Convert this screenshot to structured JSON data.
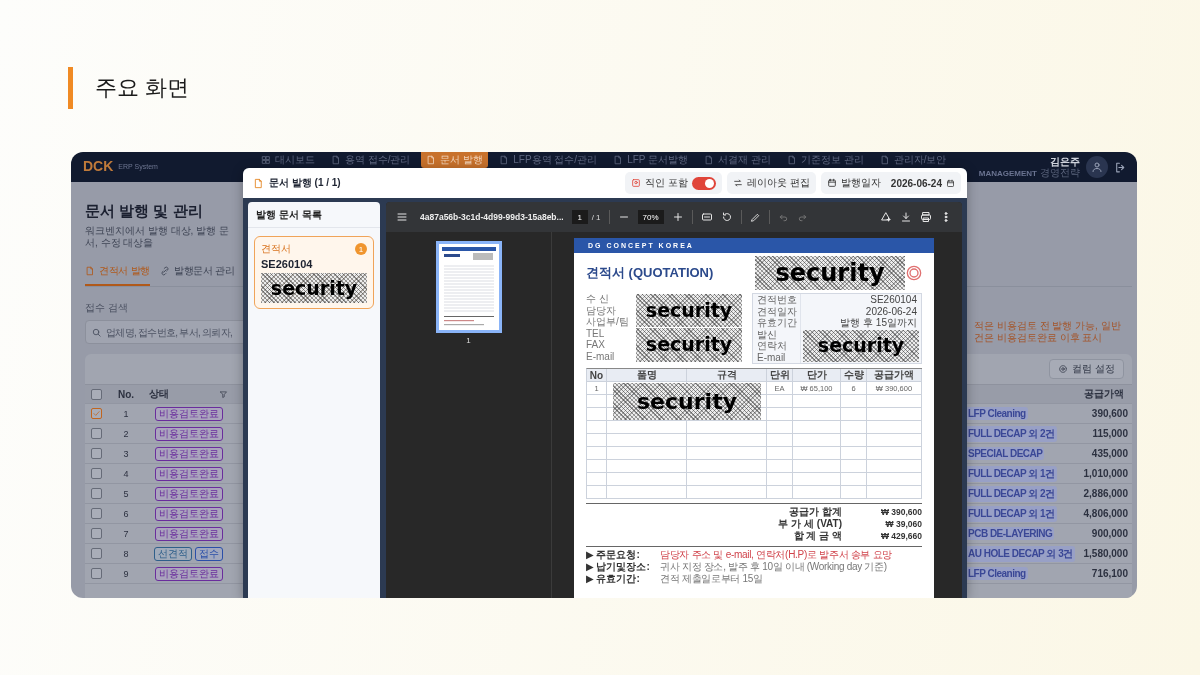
{
  "slide": {
    "title": "주요 화면"
  },
  "app": {
    "logo": "DCK",
    "logo_sub": "ERP System",
    "nav": [
      {
        "label": "대시보드",
        "selected": false
      },
      {
        "label": "용역 접수/관리",
        "selected": false
      },
      {
        "label": "문서 발행",
        "selected": true
      },
      {
        "label": "LFP용역 접수/관리",
        "selected": false
      },
      {
        "label": "LFP 문서발행",
        "selected": false
      },
      {
        "label": "서결재 관리",
        "selected": false
      },
      {
        "label": "기준정보 관리",
        "selected": false
      },
      {
        "label": "관리자/보안",
        "selected": false
      }
    ],
    "user": {
      "name": "김은주",
      "role": "MANAGEMENT",
      "dept": "경영전략"
    },
    "page_title": "문서 발행 및 관리",
    "page_subtitle": "워크벤치에서 발행 대상, 발행 문서, 수정 대상을",
    "tabs": [
      {
        "label": "견적서 발행",
        "selected": true
      },
      {
        "label": "발행문서 관리",
        "selected": false
      }
    ],
    "search": {
      "label": "접수 검색",
      "placeholder": "업체명, 접수번호, 부서, 의뢰자,"
    },
    "note": "적은 비용검토 전 발행 가능, 일반 건은 비용검토완료 이후 표시",
    "column_settings": "컬럼 설정",
    "table": {
      "select_all": false,
      "columns": [
        "No.",
        "상태",
        "공급가액"
      ],
      "rows": [
        {
          "checked": true,
          "no": "1",
          "status": [
            {
              "label": "비용검토완료",
              "color": "#6a2d9c"
            }
          ],
          "item": "LFP Cleaning",
          "amount": "390,600"
        },
        {
          "checked": false,
          "no": "2",
          "status": [
            {
              "label": "비용검토완료",
              "color": "#6a2d9c"
            }
          ],
          "item": "FULL DECAP 외 2건",
          "amount": "115,000"
        },
        {
          "checked": false,
          "no": "3",
          "status": [
            {
              "label": "비용검토완료",
              "color": "#6a2d9c"
            }
          ],
          "item": "SPECIAL DECAP",
          "amount": "435,000"
        },
        {
          "checked": false,
          "no": "4",
          "status": [
            {
              "label": "비용검토완료",
              "color": "#6a2d9c"
            }
          ],
          "item": "FULL DECAP 외 1건",
          "amount": "1,010,000"
        },
        {
          "checked": false,
          "no": "5",
          "status": [
            {
              "label": "비용검토완료",
              "color": "#6a2d9c"
            }
          ],
          "item": "FULL DECAP 외 2건",
          "amount": "2,886,000"
        },
        {
          "checked": false,
          "no": "6",
          "status": [
            {
              "label": "비용검토완료",
              "color": "#6a2d9c"
            }
          ],
          "item": "FULL DECAP 외 1건",
          "amount": "4,806,000"
        },
        {
          "checked": false,
          "no": "7",
          "status": [
            {
              "label": "비용검토완료",
              "color": "#6a2d9c"
            }
          ],
          "item": "PCB DE-LAYERING",
          "amount": "900,000"
        },
        {
          "checked": false,
          "no": "8",
          "status": [
            {
              "label": "선견적",
              "color": "#2f5f8a"
            },
            {
              "label": "접수",
              "color": "#2b4fa8"
            }
          ],
          "item": "AU HOLE DECAP 외 3건",
          "amount": "1,580,000"
        },
        {
          "checked": false,
          "no": "9",
          "status": [
            {
              "label": "비용검토완료",
              "color": "#6a2d9c"
            }
          ],
          "item": "LFP Cleaning",
          "amount": "716,100"
        }
      ]
    }
  },
  "modal": {
    "title": "문서 발행 (1 / 1)",
    "stamp_toggle": {
      "label": "직인 포함",
      "on": true
    },
    "layout_button": "레이아웃 편집",
    "date": {
      "label": "발행일자",
      "value": "2026-06-24"
    },
    "list_title": "발행 문서 목록",
    "documents": [
      {
        "type": "견적서",
        "count": "1",
        "number": "SE260104",
        "redaction": "security",
        "selected": true
      }
    ],
    "viewer": {
      "filename": "4a87a56b-3c1d-4d99-99d3-15a8eb...",
      "page": "1",
      "page_total": "/ 1",
      "zoom": "70%",
      "thumbnails": [
        {
          "label": "1",
          "selected": true
        }
      ]
    },
    "document": {
      "company": "DG CONCEPT KOREA",
      "title": "견적서 (QUOTATION)",
      "stamp_redaction": "security",
      "recipient_labels": [
        "수 신",
        "담당자",
        "사업부/팀",
        "TEL",
        "FAX",
        "E-mail"
      ],
      "recipient_redactions": [
        "security",
        "security"
      ],
      "quote_info": [
        {
          "label": "견적번호",
          "value": "SE260104"
        },
        {
          "label": "견적일자",
          "value": "2026-06-24"
        },
        {
          "label": "유효기간",
          "value": "발행 후 15일까지"
        },
        {
          "label": "발신"
        },
        {
          "label": "연락처"
        },
        {
          "label": "E-mail"
        }
      ],
      "sender_redaction": "security",
      "item_columns": [
        "No",
        "품명",
        "규격",
        "단위",
        "단가",
        "수량",
        "공급가액"
      ],
      "items": [
        {
          "no": "1",
          "unit": "EA",
          "price": "₩ 65,100",
          "qty": "6",
          "amount": "₩ 390,600"
        }
      ],
      "item_redaction": "security",
      "totals": [
        {
          "label": "공급가 합계",
          "value": "₩ 390,600"
        },
        {
          "label": "부 가 세 (VAT)",
          "value": "₩ 39,060"
        },
        {
          "label": "합 계 금 액",
          "value": "₩ 429,660"
        }
      ],
      "notes": [
        {
          "label": "▶ 주문요청:",
          "text": "담당자 주소 및 e-mail, 연락처(H.P)로 발주서 송부 요망",
          "highlight": true
        },
        {
          "label": "▶ 납기및장소:",
          "text": "귀사 지정 장소, 발주 후 10일 이내 (Working day 기준)",
          "highlight": false
        },
        {
          "label": "▶ 유효기간:",
          "text": "견적 제출일로부터 15일",
          "highlight": false
        }
      ]
    }
  }
}
